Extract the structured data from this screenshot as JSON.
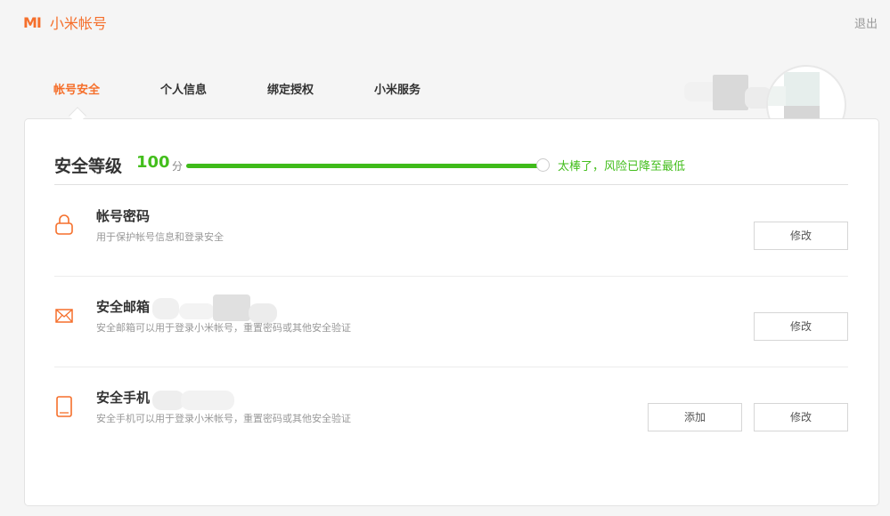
{
  "app": {
    "logo_mark": "MI",
    "title": "小米帐号",
    "logout": "退出"
  },
  "tabs": [
    {
      "label": "帐号安全",
      "active": true
    },
    {
      "label": "个人信息",
      "active": false
    },
    {
      "label": "绑定授权",
      "active": false
    },
    {
      "label": "小米服务",
      "active": false
    }
  ],
  "score": {
    "title": "安全等级",
    "value": "100",
    "unit": "分",
    "progress_percent": 100,
    "message": "太棒了，风险已降至最低"
  },
  "items": [
    {
      "icon": "lock-icon",
      "title": "帐号密码",
      "desc": "用于保护帐号信息和登录安全",
      "buttons": [
        "修改"
      ]
    },
    {
      "icon": "mail-icon",
      "title": "安全邮箱",
      "desc": "安全邮箱可以用于登录小米帐号，重置密码或其他安全验证",
      "buttons": [
        "修改"
      ]
    },
    {
      "icon": "phone-icon",
      "title": "安全手机",
      "desc": "安全手机可以用于登录小米帐号，重置密码或其他安全验证",
      "buttons": [
        "添加",
        "修改"
      ]
    }
  ],
  "colors": {
    "accent": "#f56f2b",
    "success": "#43be1c"
  }
}
